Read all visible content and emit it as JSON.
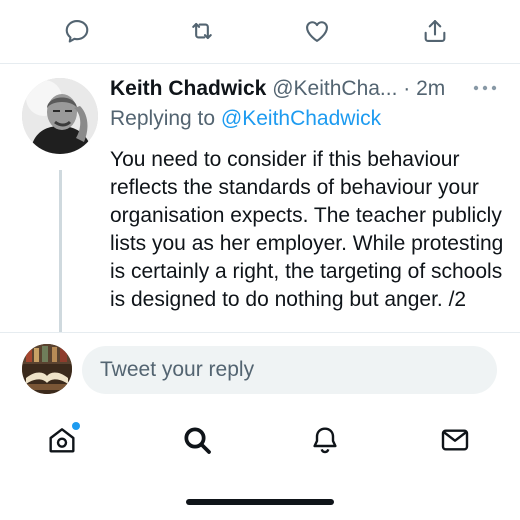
{
  "actions": {
    "reply_icon": "reply-bubble",
    "retweet_icon": "retweet-arrows",
    "like_icon": "heart-outline",
    "share_icon": "share-upload"
  },
  "reply": {
    "author_name": "Keith Chadwick",
    "handle": "@KeithCha...",
    "time": "· 2m",
    "replying_prefix": "Replying to",
    "replying_handle": "@KeithChadwick",
    "body": "You need to consider if this behaviour reflects the standards of behaviour your organisation expects. The teacher publicly lists you as her employer. While protesting is certainly a right, the targeting of schools is designed to do nothing but anger. /2"
  },
  "composer": {
    "placeholder": "Tweet your reply"
  },
  "tabbar": {
    "items": [
      "home",
      "search",
      "notifications",
      "messages"
    ],
    "home_has_new": true
  },
  "colors": {
    "accent": "#1d9bf0",
    "text_primary": "#0f1419",
    "text_secondary": "#536471",
    "input_bg": "#eff3f4"
  }
}
